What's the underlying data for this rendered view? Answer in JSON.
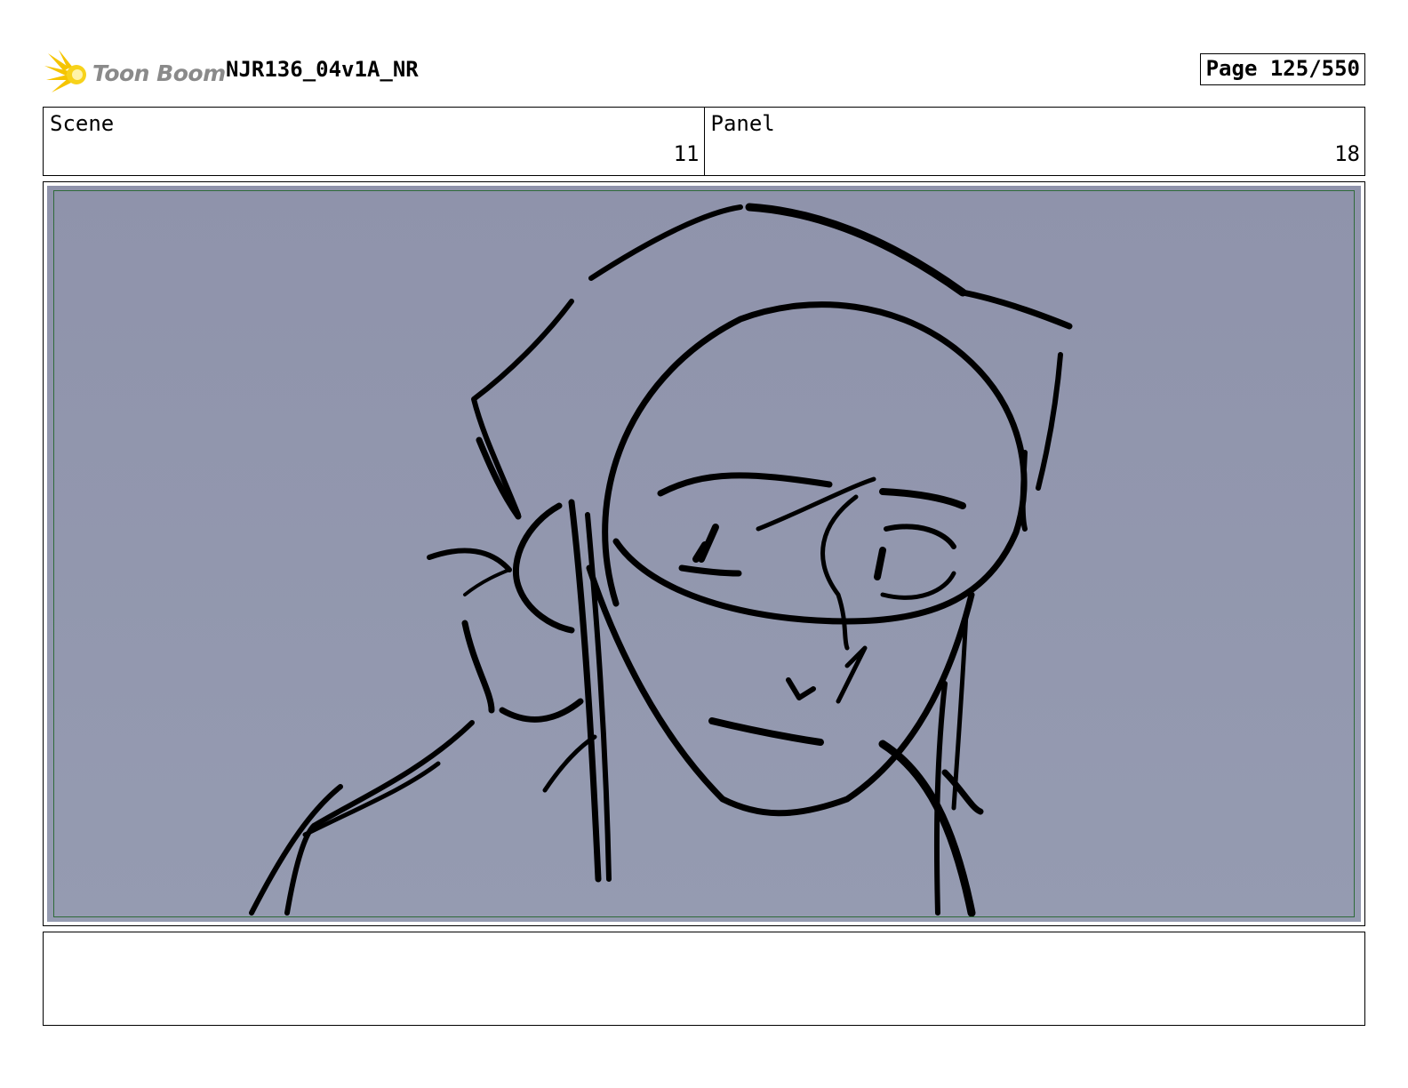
{
  "header": {
    "logo_text": "Toon Boom",
    "doc_title": "NJR136_04v1A_NR",
    "page_label": "Page 125/550"
  },
  "info": {
    "scene_label": "Scene",
    "scene_value": "11",
    "panel_label": "Panel",
    "panel_value": "18"
  },
  "notes": {
    "text": ""
  },
  "colors": {
    "panel_background": "#9196ae",
    "safe_frame": "#2f6a3a",
    "logo_yellow": "#f5c400",
    "logo_text": "#8a8a8a"
  }
}
